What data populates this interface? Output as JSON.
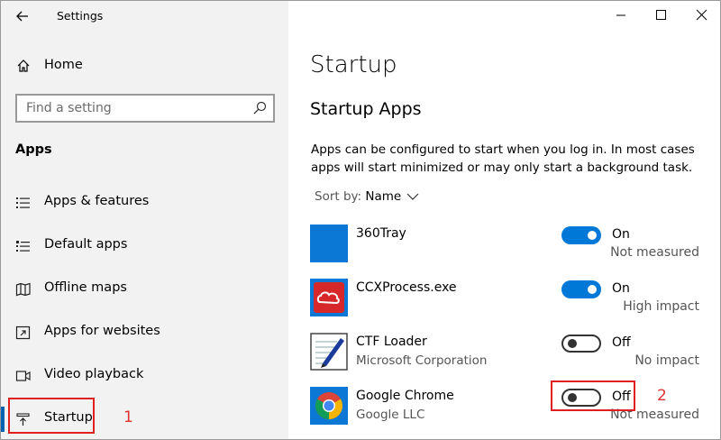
{
  "window": {
    "title": "Settings"
  },
  "sidebar": {
    "home_label": "Home",
    "search_placeholder": "Find a setting",
    "section_title": "Apps",
    "items": [
      {
        "label": "Apps & features",
        "icon": "list-icon"
      },
      {
        "label": "Default apps",
        "icon": "default-apps-icon"
      },
      {
        "label": "Offline maps",
        "icon": "map-icon"
      },
      {
        "label": "Apps for websites",
        "icon": "website-icon"
      },
      {
        "label": "Video playback",
        "icon": "video-icon"
      },
      {
        "label": "Startup",
        "icon": "startup-icon",
        "active": true
      }
    ]
  },
  "main": {
    "title": "Startup",
    "subtitle": "Startup Apps",
    "description": "Apps can be configured to start when you log in. In most cases apps will start minimized or may only start a background task.",
    "sort_prefix": "Sort by:",
    "sort_value": "Name",
    "apps": [
      {
        "name": "360Tray",
        "publisher": "",
        "state": "On",
        "enabled": true,
        "impact": "Not measured"
      },
      {
        "name": "CCXProcess.exe",
        "publisher": "",
        "state": "On",
        "enabled": true,
        "impact": "High impact"
      },
      {
        "name": "CTF Loader",
        "publisher": "Microsoft Corporation",
        "state": "Off",
        "enabled": false,
        "impact": "No impact"
      },
      {
        "name": "Google Chrome",
        "publisher": "Google LLC",
        "state": "Off",
        "enabled": false,
        "impact": "Not measured"
      }
    ]
  },
  "annotations": {
    "first": "1",
    "second": "2"
  },
  "colors": {
    "accent": "#0078d7",
    "annotation": "#e02020"
  }
}
